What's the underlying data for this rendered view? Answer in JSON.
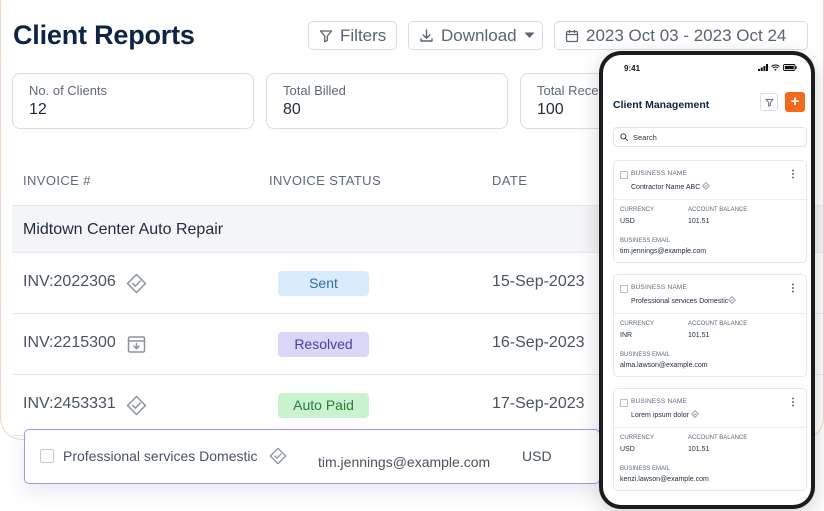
{
  "header": {
    "title": "Client Reports",
    "filters_label": "Filters",
    "download_label": "Download",
    "date_range": "2023 Oct 03 - 2023 Oct 24"
  },
  "stats": [
    {
      "label": "No. of Clients",
      "value": "12"
    },
    {
      "label": "Total Billed",
      "value": "80"
    },
    {
      "label": "Total Rece",
      "value": "100"
    }
  ],
  "table": {
    "columns": [
      "INVOICE #",
      "INVOICE STATUS",
      "DATE"
    ],
    "group": "Midtown Center Auto Repair",
    "rows": [
      {
        "invoice": "INV:2022306",
        "icon": "verified-badge-icon",
        "status": "Sent",
        "date": "15-Sep-2023"
      },
      {
        "invoice": "INV:2215300",
        "icon": "archive-download-icon",
        "status": "Resolved",
        "date": "16-Sep-2023"
      },
      {
        "invoice": "INV:2453331",
        "icon": "verified-badge-icon",
        "status": "Auto Paid",
        "date": "17-Sep-2023"
      }
    ]
  },
  "floating_row": {
    "name": "Professional services Domestic",
    "email": "tim.jennings@example.com",
    "currency": "USD"
  },
  "phone": {
    "time": "9:41",
    "title": "Client Management",
    "add_label": "+",
    "search_placeholder": "Search",
    "labels": {
      "business_name": "BUSINESS NAME",
      "currency": "CURRENCY",
      "account_balance": "ACCOUNT BALANCE",
      "business_email": "BUSINESS EMAIL",
      "menu": "⋮"
    },
    "cards": [
      {
        "name": "Contractor Name ABC",
        "currency": "USD",
        "balance": "101.51",
        "email": "tim.jennings@example.com"
      },
      {
        "name": "Professional services Domestic",
        "currency": "INR",
        "balance": "101.51",
        "email": "alma.lawson@example.com"
      },
      {
        "name": "Lorem ipsum dolor",
        "currency": "USD",
        "balance": "101.51",
        "email": "kenzi.lawson@example.com"
      }
    ]
  },
  "colors": {
    "accent_orange": "#f26b1d",
    "status_sent_bg": "#d8ecfb",
    "status_resolved_bg": "#d9d6f7",
    "status_paid_bg": "#c9f2cf",
    "title_navy": "#0f2342"
  }
}
